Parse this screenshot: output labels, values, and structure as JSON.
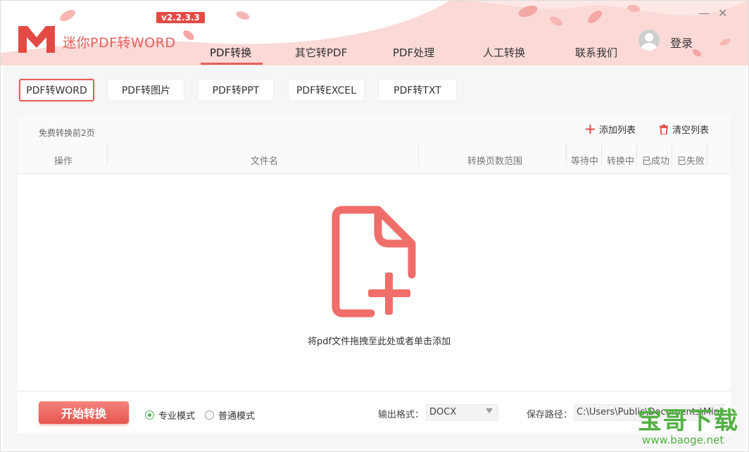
{
  "app": {
    "title": "迷你PDF转WORD",
    "version": "v2.2.3.3"
  },
  "nav": {
    "items": [
      "PDF转换",
      "其它转PDF",
      "PDF处理",
      "人工转换",
      "联系我们"
    ],
    "active_index": 0
  },
  "user": {
    "login_label": "登录"
  },
  "window_controls": {
    "minimize": "—",
    "close": "✕"
  },
  "subtabs": [
    "PDF转WORD",
    "PDF转图片",
    "PDF转PPT",
    "PDF转EXCEL",
    "PDF转TXT"
  ],
  "list": {
    "free_note": "免费转换前2页",
    "add_label": "添加列表",
    "clear_label": "清空列表",
    "columns": [
      "操作",
      "文件名",
      "转换页数范围",
      "等待中",
      "转换中",
      "已成功",
      "已失败"
    ],
    "drop_text": "将pdf文件拖拽至此处或者单击添加"
  },
  "bottom": {
    "start_label": "开始转换",
    "mode_pro": "专业模式",
    "mode_normal": "普通模式",
    "selected_mode": "专业模式",
    "format_label": "输出格式：",
    "format_value": "DOCX",
    "path_label": "保存路径：",
    "path_value": "C:\\Users\\Public\\Documents\\Mini"
  },
  "watermark": {
    "big": "宝哥下载",
    "small": "www.baoge.net"
  },
  "colors": {
    "accent": "#e5605c",
    "header_bg": "#fbd5d2",
    "radio_on": "#4caf50",
    "watermark": "#52b043"
  },
  "icons": [
    "logo-m-icon",
    "avatar-icon",
    "plus-icon",
    "trash-icon",
    "add-file-icon",
    "dropdown-arrow-icon"
  ]
}
